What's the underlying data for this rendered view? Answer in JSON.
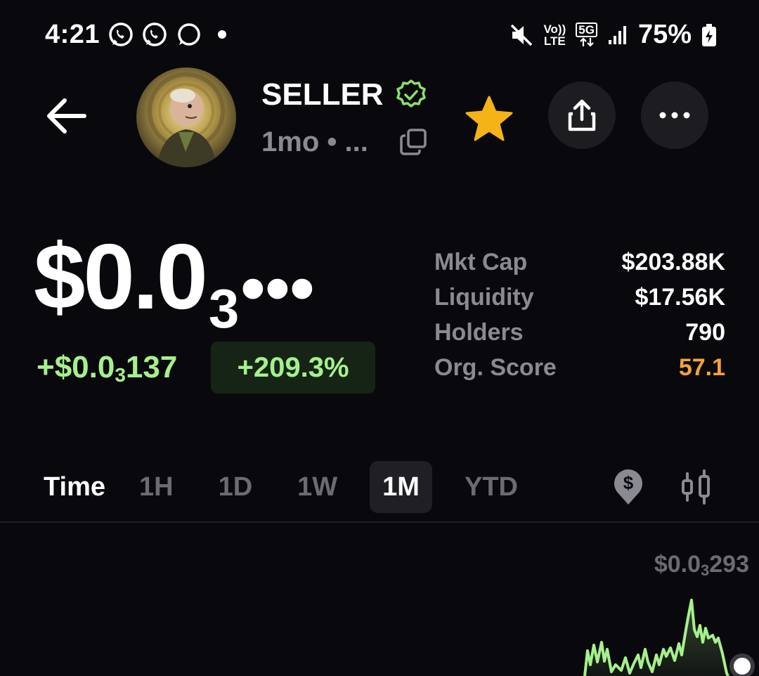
{
  "status_bar": {
    "time": "4:21",
    "left_icons": [
      "whatsapp-icon",
      "whatsapp-icon",
      "chat-bubble-icon"
    ],
    "network_top": "Vo))",
    "network_bottom": "LTE",
    "network_type": "5G",
    "battery_percent": "75%"
  },
  "header": {
    "token_name": "SELLER",
    "age": "1mo • ...",
    "verified_color": "#8be06c",
    "star_color": "#f5b316"
  },
  "price": {
    "prefix": "$0.0",
    "zeros_sub": "3",
    "suffix": "•••",
    "change_prefix": "+$0.0",
    "change_sub": "3",
    "change_suffix": "137",
    "change_pct": "+209.3%",
    "positive_color": "#a6f08c"
  },
  "stats": [
    {
      "label": "Mkt Cap",
      "value": "$203.88K"
    },
    {
      "label": "Liquidity",
      "value": "$17.56K"
    },
    {
      "label": "Holders",
      "value": "790"
    },
    {
      "label": "Org. Score",
      "value": "57.1"
    }
  ],
  "timeframe": {
    "title": "Time",
    "options": [
      "1H",
      "1D",
      "1W",
      "1M",
      "YTD"
    ],
    "selected": "1M"
  },
  "chart": {
    "high_prefix": "$0.0",
    "high_sub": "3",
    "high_suffix": "293",
    "line_color": "#a6f08c"
  }
}
